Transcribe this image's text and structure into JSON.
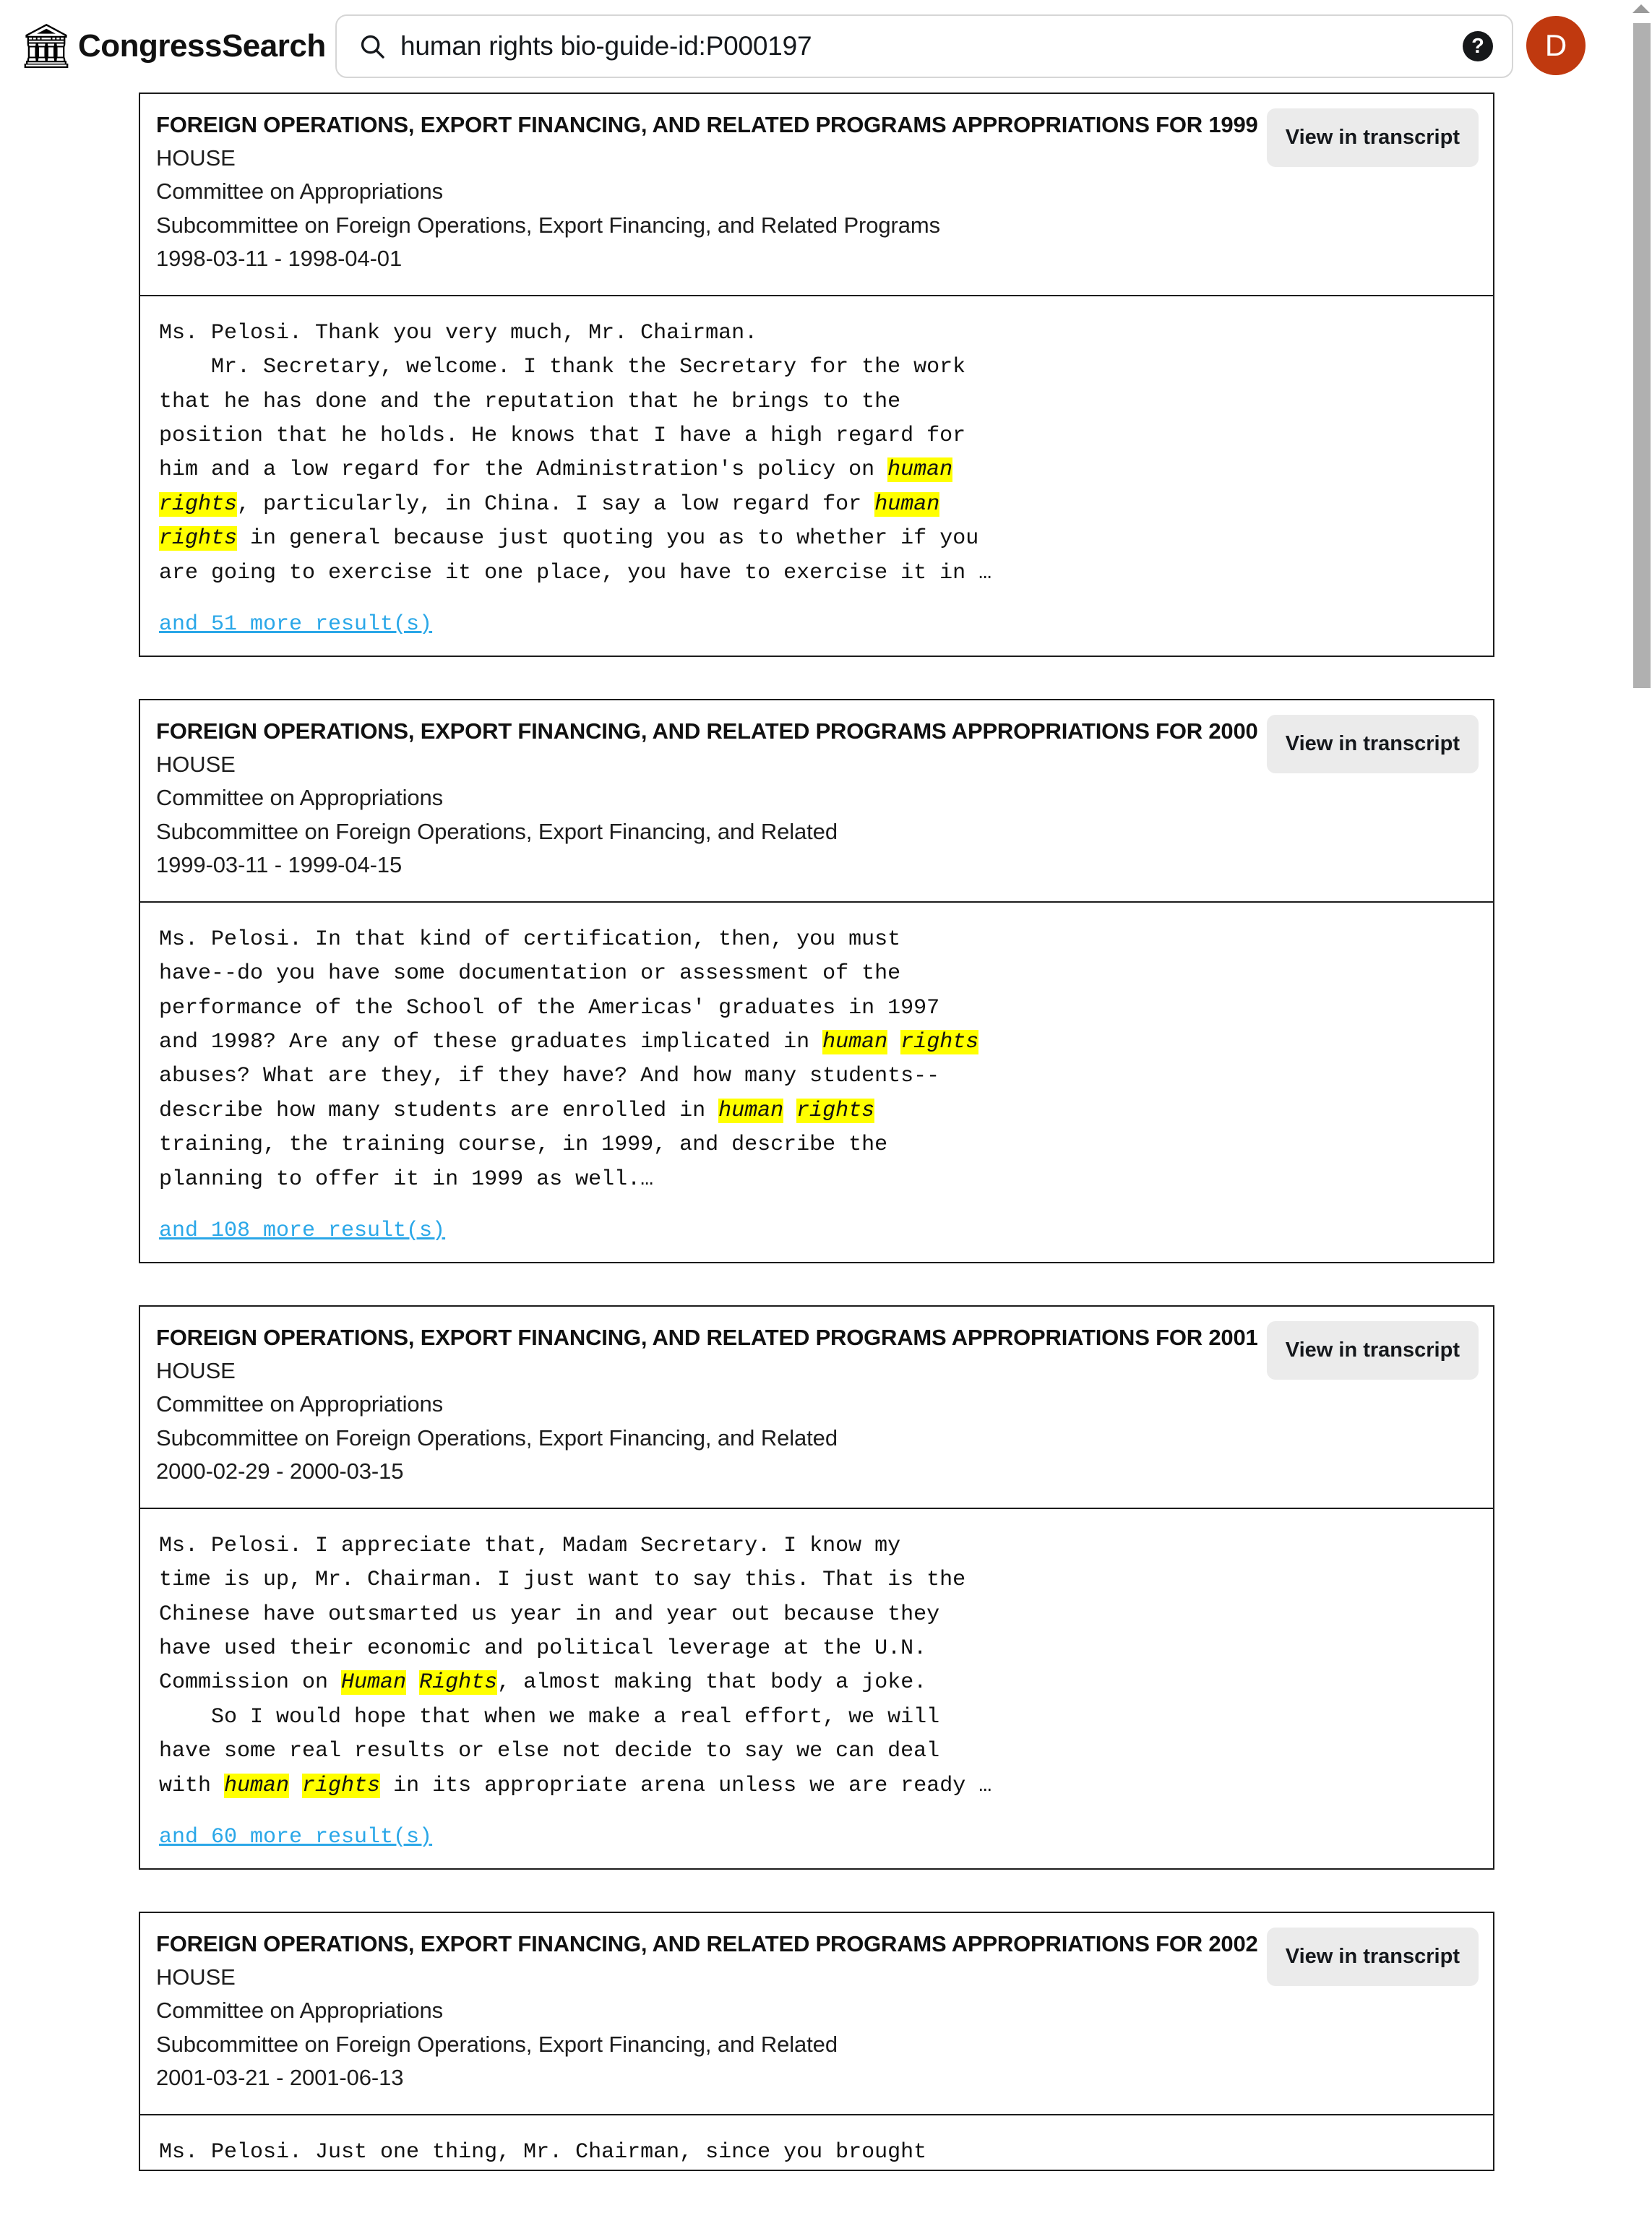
{
  "header": {
    "brand_icon": "classical-building-emoji",
    "brand_icon_glyph": "🏛",
    "brand_name": "CongressSearch",
    "search_value": "human rights bio-guide-id:P000197",
    "search_placeholder": "Search",
    "search_icon": "search-icon",
    "help_icon": "help-icon",
    "help_glyph": "?",
    "avatar_initial": "D",
    "avatar_color": "#c0390f"
  },
  "results": [
    {
      "title": "FOREIGN OPERATIONS, EXPORT FINANCING, AND RELATED PROGRAMS APPROPRIATIONS FOR 1999",
      "chamber": "HOUSE",
      "committee": "Committee on Appropriations",
      "subcommittee": "Subcommittee on Foreign Operations, Export Financing, and Related Programs",
      "date_range": "1998-03-11 - 1998-04-01",
      "button_label": "View in transcript",
      "excerpt_parts": [
        {
          "t": "Ms. Pelosi. Thank you very much, Mr. Chairman.\n    Mr. Secretary, welcome. I thank the Secretary for the work\nthat he has done and the reputation that he brings to the\nposition that he holds. He knows that I have a high regard for\nhim and a low regard for the Administration's policy on ",
          "h": false
        },
        {
          "t": "human",
          "h": true
        },
        {
          "t": "\n",
          "h": false
        },
        {
          "t": "rights",
          "h": true
        },
        {
          "t": ", particularly, in China. I say a low regard for ",
          "h": false
        },
        {
          "t": "human",
          "h": true
        },
        {
          "t": "\n",
          "h": false
        },
        {
          "t": "rights",
          "h": true
        },
        {
          "t": " in general because just quoting you as to whether if you\nare going to exercise it one place, you have to exercise it in …",
          "h": false
        }
      ],
      "more_link": "and 51 more result(s)"
    },
    {
      "title": "FOREIGN OPERATIONS, EXPORT FINANCING, AND RELATED PROGRAMS APPROPRIATIONS FOR 2000",
      "chamber": "HOUSE",
      "committee": "Committee on Appropriations",
      "subcommittee": "Subcommittee on Foreign Operations, Export Financing, and Related",
      "date_range": "1999-03-11 - 1999-04-15",
      "button_label": "View in transcript",
      "excerpt_parts": [
        {
          "t": "Ms. Pelosi. In that kind of certification, then, you must\nhave--do you have some documentation or assessment of the\nperformance of the School of the Americas' graduates in 1997\nand 1998? Are any of these graduates implicated in ",
          "h": false
        },
        {
          "t": "human",
          "h": true
        },
        {
          "t": " ",
          "h": false
        },
        {
          "t": "rights",
          "h": true
        },
        {
          "t": "\nabuses? What are they, if they have? And how many students--\ndescribe how many students are enrolled in ",
          "h": false
        },
        {
          "t": "human",
          "h": true
        },
        {
          "t": " ",
          "h": false
        },
        {
          "t": "rights",
          "h": true
        },
        {
          "t": "\ntraining, the training course, in 1999, and describe the\nplanning to offer it in 1999 as well.…",
          "h": false
        }
      ],
      "more_link": "and 108 more result(s)"
    },
    {
      "title": "FOREIGN OPERATIONS, EXPORT FINANCING, AND RELATED PROGRAMS APPROPRIATIONS FOR 2001",
      "chamber": "HOUSE",
      "committee": "Committee on Appropriations",
      "subcommittee": "Subcommittee on Foreign Operations, Export Financing, and Related",
      "date_range": "2000-02-29 - 2000-03-15",
      "button_label": "View in transcript",
      "excerpt_parts": [
        {
          "t": "Ms. Pelosi. I appreciate that, Madam Secretary. I know my\ntime is up, Mr. Chairman. I just want to say this. That is the\nChinese have outsmarted us year in and year out because they\nhave used their economic and political leverage at the U.N.\nCommission on ",
          "h": false
        },
        {
          "t": "Human",
          "h": true
        },
        {
          "t": " ",
          "h": false
        },
        {
          "t": "Rights",
          "h": true
        },
        {
          "t": ", almost making that body a joke.\n    So I would hope that when we make a real effort, we will\nhave some real results or else not decide to say we can deal\nwith ",
          "h": false
        },
        {
          "t": "human",
          "h": true
        },
        {
          "t": " ",
          "h": false
        },
        {
          "t": "rights",
          "h": true
        },
        {
          "t": " in its appropriate arena unless we are ready …",
          "h": false
        }
      ],
      "more_link": "and 60 more result(s)"
    },
    {
      "title": "FOREIGN OPERATIONS, EXPORT FINANCING, AND RELATED PROGRAMS APPROPRIATIONS FOR 2002",
      "chamber": "HOUSE",
      "committee": "Committee on Appropriations",
      "subcommittee": "Subcommittee on Foreign Operations, Export Financing, and Related",
      "date_range": "2001-03-21 - 2001-06-13",
      "button_label": "View in transcript",
      "excerpt_parts": [
        {
          "t": "Ms. Pelosi. Just one thing, Mr. Chairman, since you brought",
          "h": false
        }
      ],
      "more_link": null
    }
  ],
  "scrollbar": {
    "up_arrow": "scroll-up-arrow"
  }
}
